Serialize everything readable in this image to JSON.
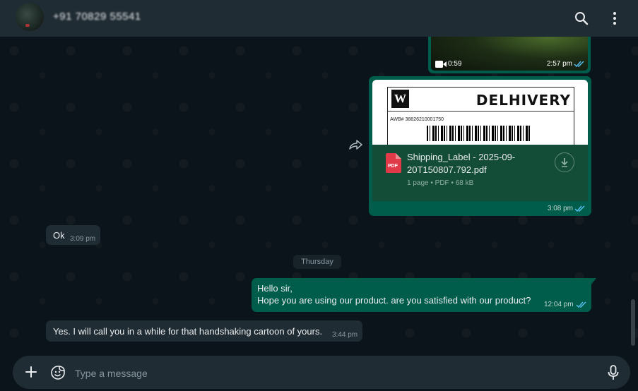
{
  "header": {
    "contact_name": "+91 70829 55541",
    "search_icon": "search-icon",
    "menu_icon": "kebab-menu-icon"
  },
  "messages": {
    "video": {
      "duration": "0:59",
      "time": "2:57 pm",
      "status": "read"
    },
    "document": {
      "preview_awb": "AWB# 38826210001750",
      "preview_brand_logo": "W",
      "preview_brand": "DELHIVERY",
      "file_name": "Shipping_Label - 2025-09-20T150807.792.pdf",
      "meta": "1 page • PDF • 68 kB",
      "time": "3:08 pm",
      "status": "read",
      "icon": "pdf-icon"
    },
    "ok": {
      "text": "Ok",
      "time": "3:09 pm"
    },
    "day_separator": "Thursday",
    "hello": {
      "line1": "Hello sir,",
      "line2": "Hope you are using our product. are you satisfied with our product?",
      "time": "12:04 pm",
      "status": "read"
    },
    "yes": {
      "text": "Yes. I will call you in a while for that handshaking cartoon of yours.",
      "time": "3:44 pm"
    }
  },
  "composer": {
    "placeholder": "Type a message",
    "value": ""
  },
  "colors": {
    "outgoing_bubble": "#005c4b",
    "incoming_bubble": "#202c33",
    "background": "#0b141a",
    "read_tick": "#53bdeb"
  }
}
